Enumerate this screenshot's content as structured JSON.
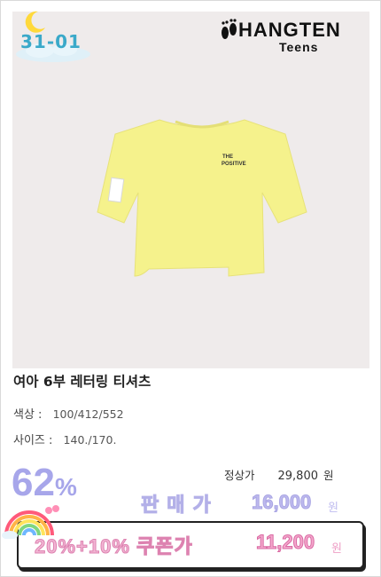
{
  "badge": {
    "code": "31-01"
  },
  "brand": {
    "name": "HANGTEN",
    "sub": "Teens"
  },
  "product": {
    "title": "여아 6부 레터링 티셔츠",
    "print_line1": "THE",
    "print_line2": "POSITIVE"
  },
  "specs": {
    "color_label": "색상 :",
    "color_value": "100/412/552",
    "size_label": "사이즈 :",
    "size_value": "140./170."
  },
  "pricing": {
    "discount_number": "62",
    "discount_symbol": "%",
    "regular_label": "정상가",
    "regular_amount": "29,800",
    "regular_unit": "원",
    "sale_label": "판매가",
    "sale_amount": "16,000",
    "sale_unit": "원",
    "coupon_label": "20%+10% 쿠폰가",
    "coupon_amount": "11,200",
    "coupon_unit": "원"
  },
  "colors": {
    "shirt": "#f5f28c",
    "photo_bg": "#efebeb",
    "discount": "#a7a6ea",
    "coupon_pink": "#f4a7cc"
  }
}
